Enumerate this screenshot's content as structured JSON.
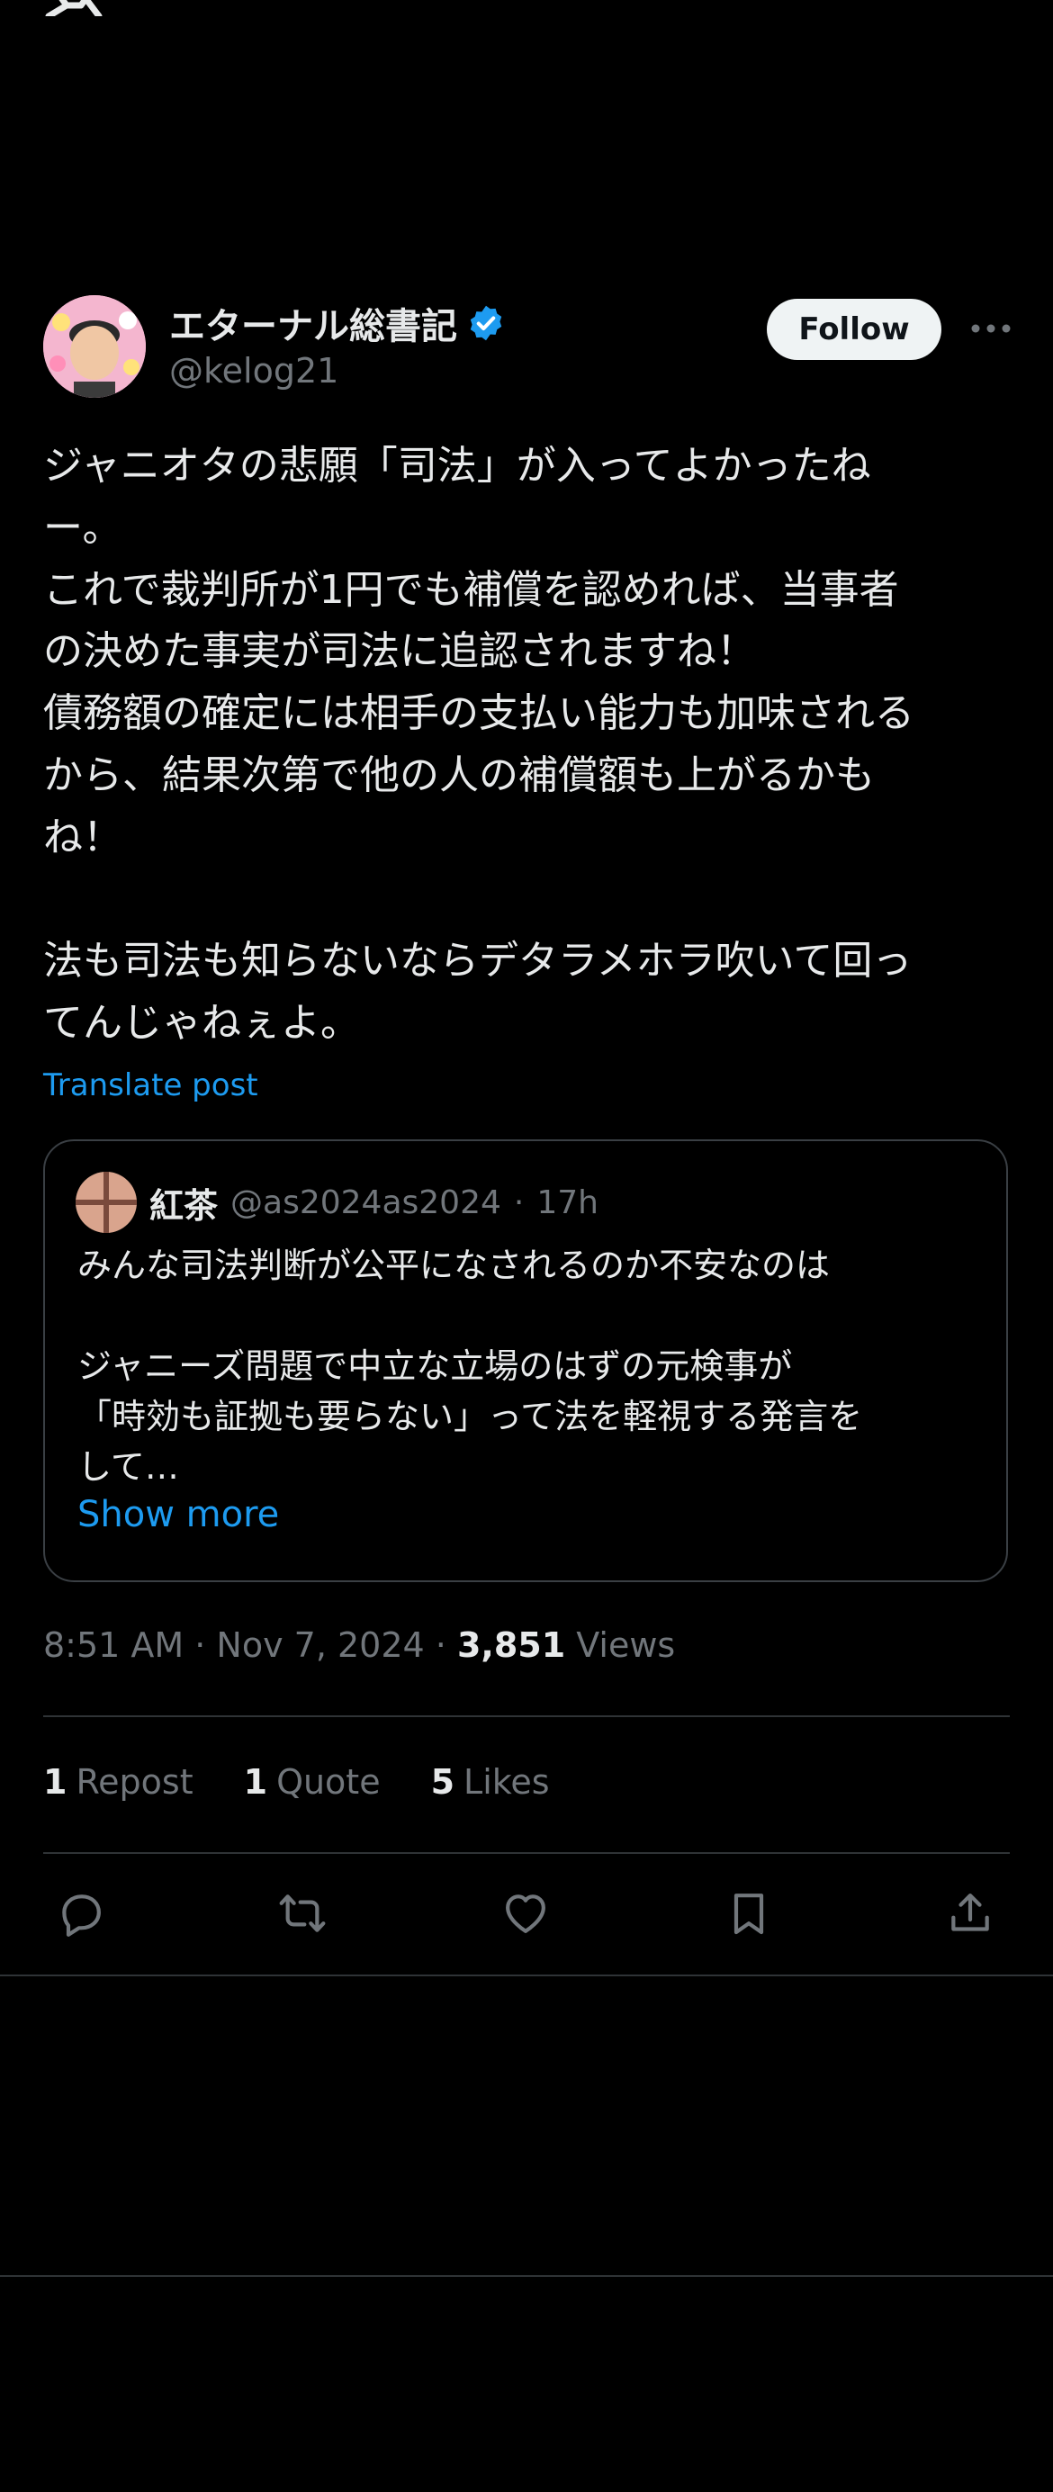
{
  "post": {
    "author_name": "エターナル総書記",
    "author_handle": "@kelog21",
    "follow_label": "Follow",
    "text": "ジャニオタの悲願「司法」が入ってよかったね\nー。\nこれで裁判所が1円でも補償を認めれば、当事者\nの決めた事実が司法に追認されますね！\n債務額の確定には相手の支払い能力も加味される\nから、結果次第で他の人の補償額も上がるかも\nね！\n\n法も司法も知らないならデタラメホラ吹いて回っ\nてんじゃねぇよ。",
    "translate_label": "Translate post"
  },
  "quote": {
    "author_name": "紅茶",
    "author_handle": "@as2024as2024",
    "separator": "·",
    "time": "17h",
    "text": "みんな司法判断が公平になされるのか不安なのは\n\nジャニーズ問題で中立な立場のはずの元検事が\n「時効も証拠も要らない」って法を軽視する発言を\nして…",
    "show_more_label": "Show more"
  },
  "meta": {
    "timestamp": "8:51 AM · Nov 7, 2024 · ",
    "views_count": "3,851",
    "views_label": " Views"
  },
  "stats": {
    "reposts_count": "1",
    "reposts_label": "Repost",
    "quotes_count": "1",
    "quotes_label": "Quote",
    "likes_count": "5",
    "likes_label": "Likes"
  },
  "icons": {
    "logo": "x-logo-icon",
    "verified": "verified-badge-icon",
    "more": "more-dots-icon",
    "reply": "reply-icon",
    "repost": "repost-icon",
    "like": "heart-icon",
    "bookmark": "bookmark-icon",
    "share": "share-icon"
  },
  "colors": {
    "background": "#000000",
    "text": "#e7e9ea",
    "secondary": "#71767b",
    "link": "#1d9bf0",
    "verified": "#1d9bf0",
    "follow_bg": "#eff3f4"
  }
}
